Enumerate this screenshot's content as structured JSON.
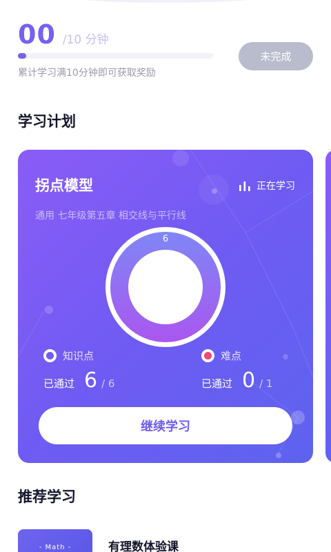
{
  "progress": {
    "current": "00",
    "total": "/10 分钟",
    "fraction": 0.0,
    "hint": "累计学习满10分钟即可获取奖励",
    "status_label": "未完成"
  },
  "plan": {
    "section_title": "学习计划",
    "card": {
      "title": "拐点模型",
      "status": "正在学习",
      "subtitle": "通用 七年级第五章 相交线与平行线",
      "ring_value": "6",
      "knowledge": {
        "label": "知识点",
        "passed_label": "已通过",
        "passed": "6",
        "total": "/ 6"
      },
      "difficulty": {
        "label": "难点",
        "passed_label": "已通过",
        "passed": "0",
        "total": "/ 1"
      },
      "continue_label": "继续学习"
    }
  },
  "recommend": {
    "section_title": "推荐学习",
    "items": [
      {
        "thumb_label": "- Math -",
        "title": "有理数体验课"
      }
    ]
  },
  "colors": {
    "accent": "#7561f2",
    "status_gray": "#b9bccd",
    "card_start": "#8a5cf6",
    "card_end": "#5d63ef",
    "difficulty_dot": "#f0467a"
  },
  "icons": {
    "status": "bar-chart-icon"
  }
}
